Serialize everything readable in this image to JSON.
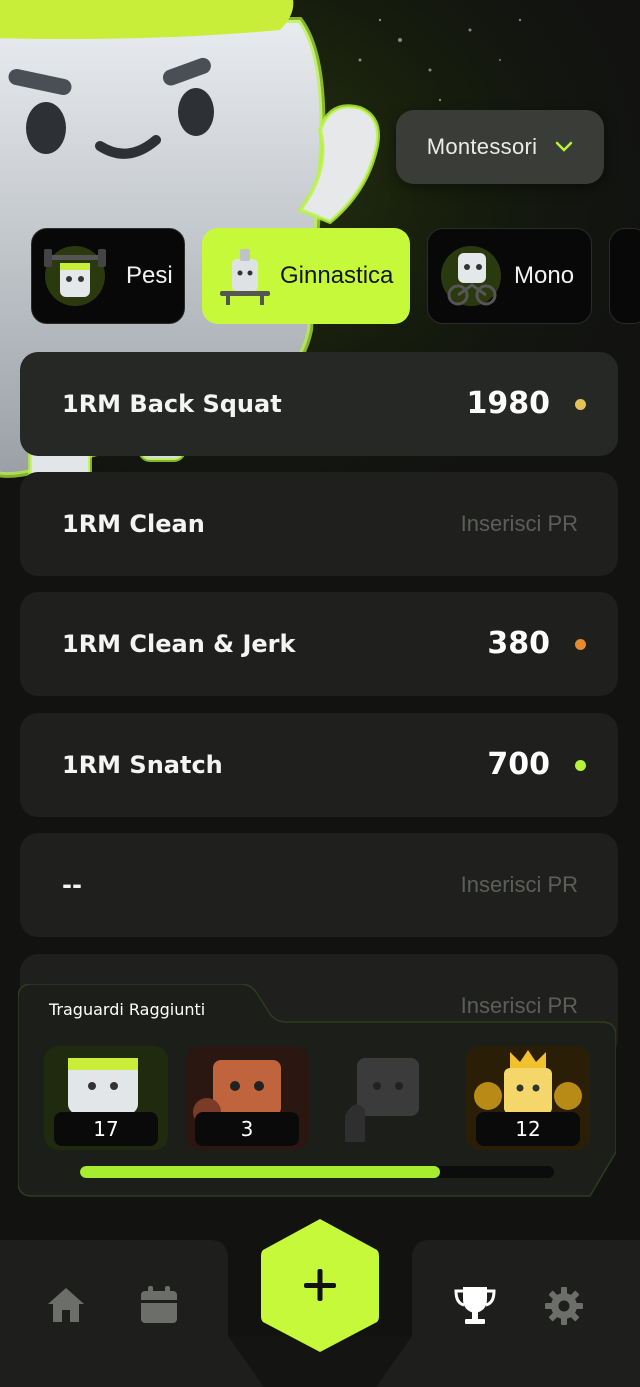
{
  "header": {
    "gym_selector": {
      "value": "Montessori",
      "icon": "chevron-down-icon"
    }
  },
  "categories": [
    {
      "label": "Pesi",
      "icon": "mascot-weights-icon",
      "active": false
    },
    {
      "label": "Ginnastica",
      "icon": "mascot-gymnastics-icon",
      "active": true
    },
    {
      "label": "Mono",
      "icon": "mascot-bike-icon",
      "active": false
    }
  ],
  "records": [
    {
      "name": "1RM Back Squat",
      "value": "1980",
      "dot_color": "#e3c15a"
    },
    {
      "name": "1RM Clean",
      "placeholder": "Inserisci PR"
    },
    {
      "name": "1RM Clean & Jerk",
      "value": "380",
      "dot_color": "#e48a2f"
    },
    {
      "name": "1RM Snatch",
      "value": "700",
      "dot_color": "#b7f23a"
    },
    {
      "name": "--",
      "placeholder": "Inserisci PR"
    },
    {
      "name": "",
      "placeholder": "Inserisci PR"
    }
  ],
  "milestones": {
    "title": "Traguardi Raggiunti",
    "badges": [
      {
        "count": "17",
        "icon": "mascot-headband-badge"
      },
      {
        "count": "3",
        "icon": "mascot-robot-badge"
      },
      {
        "count": "",
        "icon": "mascot-locked-badge"
      },
      {
        "count": "12",
        "icon": "mascot-gold-trophy-badge"
      }
    ],
    "progress": 0.76
  },
  "nav": {
    "items": [
      {
        "icon": "home-icon"
      },
      {
        "icon": "calendar-icon"
      },
      {
        "icon": "add-icon"
      },
      {
        "icon": "trophy-icon",
        "active": true
      },
      {
        "icon": "settings-icon"
      }
    ],
    "accent": "#c6f93a"
  }
}
